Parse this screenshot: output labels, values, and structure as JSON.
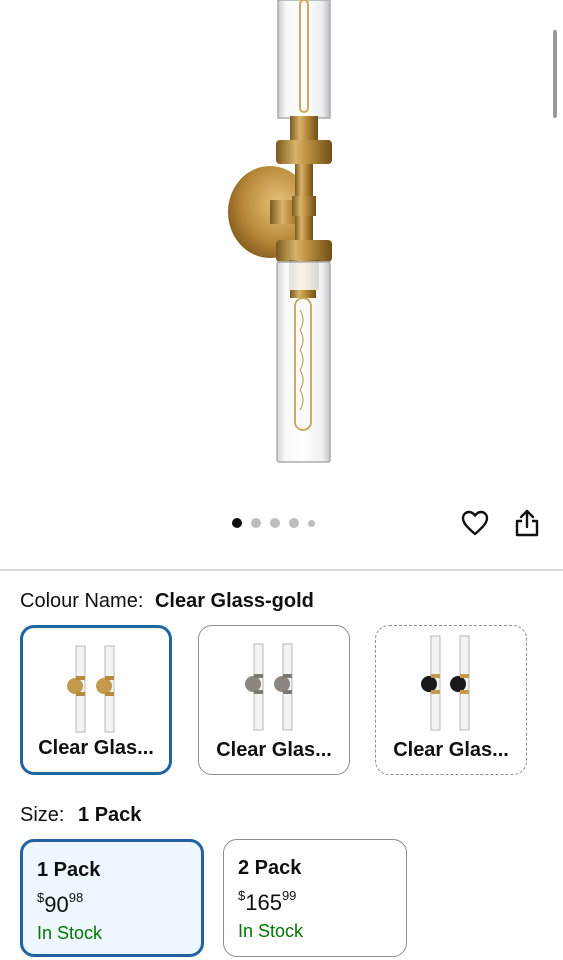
{
  "gallery": {
    "image_alt": "Brass double-cylinder wall sconce with clear glass",
    "dots": [
      true,
      false,
      false,
      false,
      false
    ],
    "icons": [
      "heart-icon",
      "share-icon"
    ]
  },
  "colour": {
    "label": "Colour Name:",
    "selected": "Clear Glass-gold",
    "options": [
      {
        "label": "Clear Glas...",
        "variant": "gold",
        "selected": true
      },
      {
        "label": "Clear Glas...",
        "variant": "nickel",
        "selected": false
      },
      {
        "label": "Clear Glas...",
        "variant": "black",
        "selected": false
      }
    ]
  },
  "size": {
    "label": "Size:",
    "selected": "1 Pack",
    "options": [
      {
        "title": "1 Pack",
        "currency": "$",
        "price_whole": "90",
        "price_fraction": "98",
        "stock": "In Stock",
        "selected": true
      },
      {
        "title": "2 Pack",
        "currency": "$",
        "price_whole": "165",
        "price_fraction": "99",
        "stock": "In Stock",
        "selected": false
      }
    ]
  },
  "colors": {
    "accent": "#2162a1",
    "in_stock": "#007600",
    "selected_bg": "#edf7fd"
  }
}
